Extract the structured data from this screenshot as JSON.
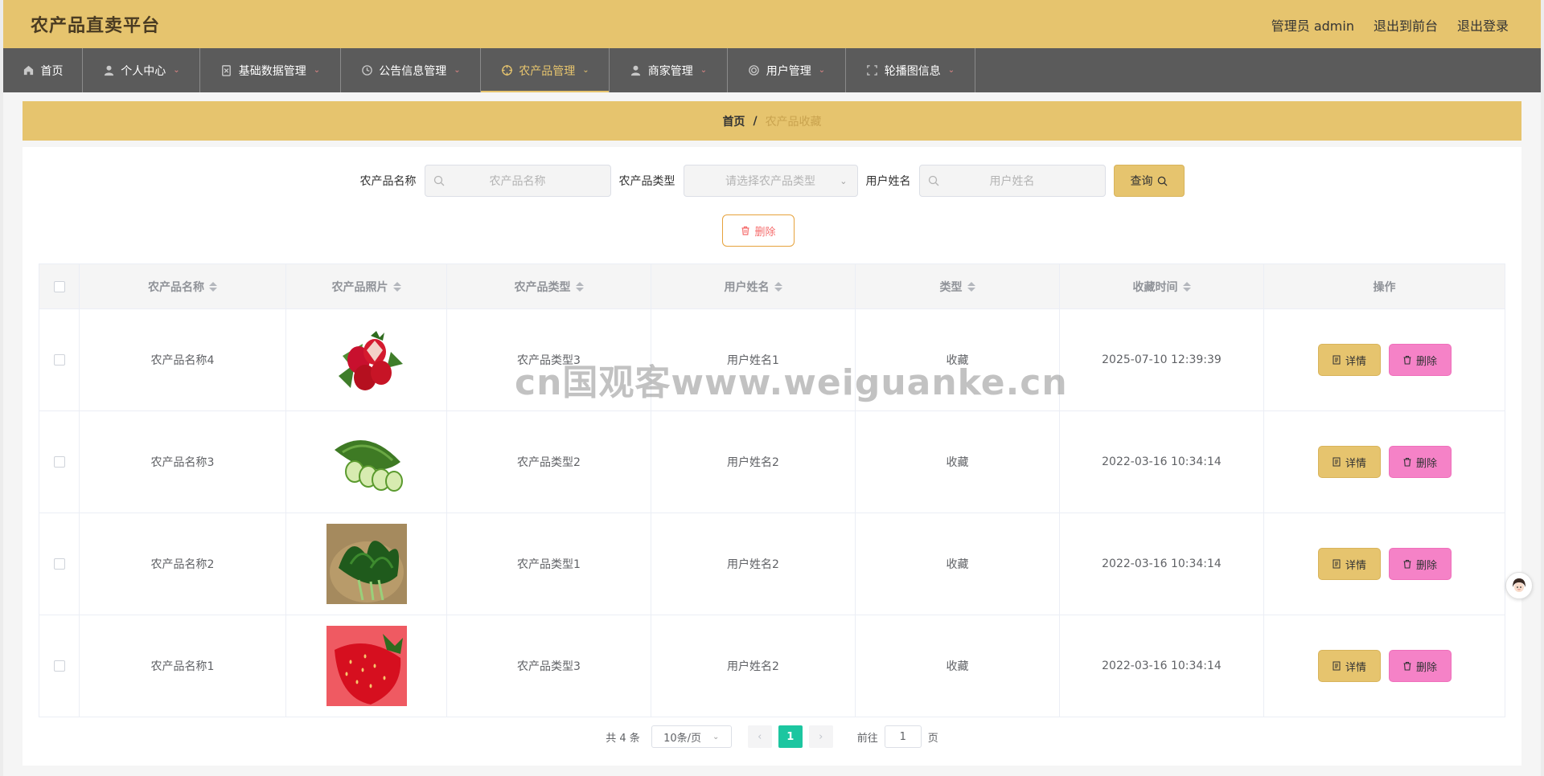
{
  "header": {
    "title": "农产品直卖平台",
    "links": [
      "管理员 admin",
      "退出到前台",
      "退出登录"
    ]
  },
  "nav": [
    {
      "label": "首页",
      "icon": "home-icon",
      "has_caret": false,
      "active": false
    },
    {
      "label": "个人中心",
      "icon": "user-icon",
      "has_caret": true,
      "active": false
    },
    {
      "label": "基础数据管理",
      "icon": "clipboard-icon",
      "has_caret": true,
      "active": false
    },
    {
      "label": "公告信息管理",
      "icon": "clock-icon",
      "has_caret": true,
      "active": false
    },
    {
      "label": "农产品管理",
      "icon": "crosshair-icon",
      "has_caret": true,
      "active": true
    },
    {
      "label": "商家管理",
      "icon": "person-icon",
      "has_caret": true,
      "active": false
    },
    {
      "label": "用户管理",
      "icon": "ring-icon",
      "has_caret": true,
      "active": false
    },
    {
      "label": "轮播图信息",
      "icon": "frame-icon",
      "has_caret": true,
      "active": false
    }
  ],
  "breadcrumb": {
    "home": "首页",
    "separator": "/",
    "current": "农产品收藏"
  },
  "search": {
    "name_label": "农产品名称",
    "name_placeholder": "农产品名称",
    "type_label": "农产品类型",
    "type_placeholder": "请选择农产品类型",
    "user_label": "用户姓名",
    "user_placeholder": "用户姓名",
    "query_label": "查询"
  },
  "toolbar": {
    "delete_label": "删除"
  },
  "table": {
    "columns": [
      "农产品名称",
      "农产品照片",
      "农产品类型",
      "用户姓名",
      "类型",
      "收藏时间",
      "操作"
    ],
    "rows": [
      {
        "name": "农产品名称4",
        "image": "strawberries-with-leaves",
        "type": "农产品类型3",
        "user": "用户姓名1",
        "kind": "收藏",
        "time": "2025-07-10 12:39:39"
      },
      {
        "name": "农产品名称3",
        "image": "cucumber-slices",
        "type": "农产品类型2",
        "user": "用户姓名2",
        "kind": "收藏",
        "time": "2022-03-16 10:34:14"
      },
      {
        "name": "农产品名称2",
        "image": "spinach-basket",
        "type": "农产品类型1",
        "user": "用户姓名2",
        "kind": "收藏",
        "time": "2022-03-16 10:34:14"
      },
      {
        "name": "农产品名称1",
        "image": "strawberry-closeup",
        "type": "农产品类型3",
        "user": "用户姓名2",
        "kind": "收藏",
        "time": "2022-03-16 10:34:14"
      }
    ],
    "detail_label": "详情",
    "remove_label": "删除"
  },
  "pagination": {
    "total": "共 4 条",
    "page_size": "10条/页",
    "current_page": "1",
    "goto_prefix": "前往",
    "goto_value": "1",
    "goto_suffix": "页"
  },
  "watermark": "cn国观客www.weiguanke.cn",
  "colors": {
    "accent": "#e6c46e",
    "nav_bg": "#5b5b5b",
    "remove": "#f582c7",
    "page_active": "#1cc6a0"
  }
}
